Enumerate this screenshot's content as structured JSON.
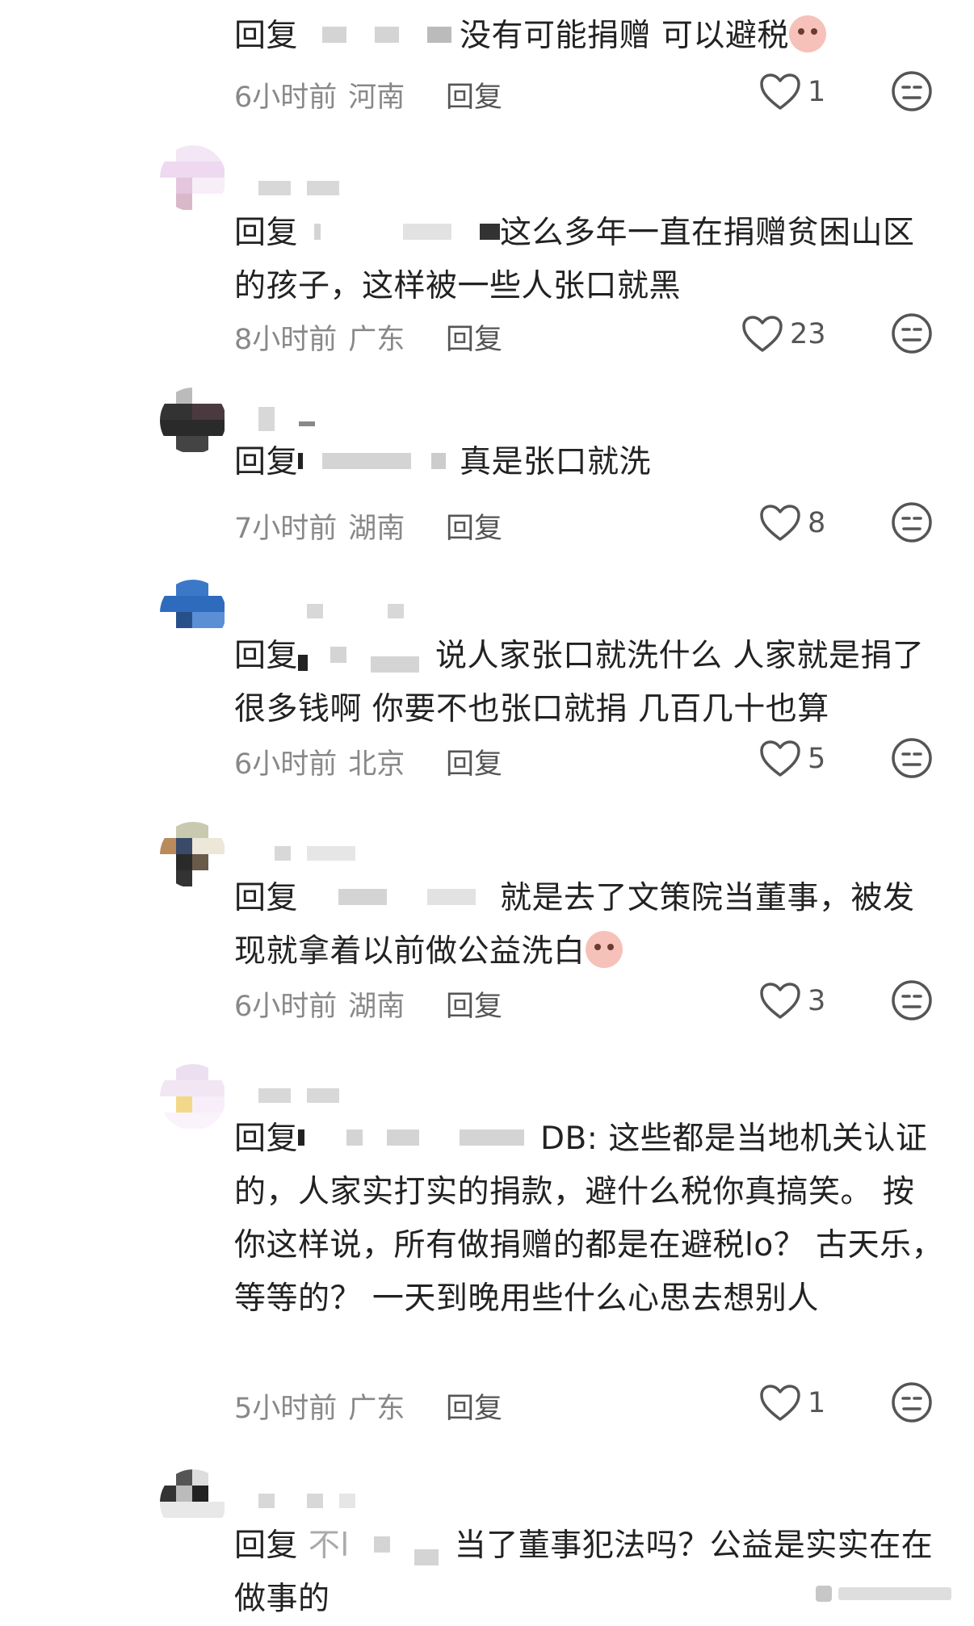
{
  "reply_label": "回复",
  "comments": [
    {
      "text_before": "",
      "text_after": "没有可能捐赠 可以避税",
      "emoji": "blush-emoji",
      "time": "6小时前",
      "location": "河南",
      "likes": "1"
    },
    {
      "text_before": "",
      "text_after": "这么多年一直在捐赠贫困山区的孩子，这样被一些人张口就黑",
      "emoji": "",
      "time": "8小时前",
      "location": "广东",
      "likes": "23"
    },
    {
      "text_before": "",
      "text_after": "真是张口就洗",
      "emoji": "",
      "time": "7小时前",
      "location": "湖南",
      "likes": "8"
    },
    {
      "text_before": "",
      "text_after": "说人家张口就洗什么 人家就是捐了很多钱啊 你要不也张口就捐 几百几十也算",
      "emoji": "",
      "time": "6小时前",
      "location": "北京",
      "likes": "5"
    },
    {
      "text_before": "",
      "text_after": "就是去了文策院当董事，被发现就拿着以前做公益洗白",
      "emoji": "thinking-emoji",
      "time": "6小时前",
      "location": "湖南",
      "likes": "3"
    },
    {
      "text_before": "",
      "text_after": "DB: 这些都是当地机关认证的，人家实打实的捐款，避什么税你真搞笑。 按你这样说，所有做捐赠的都是在避税lo？ 古天乐，等等的？ 一天到晚用些什么心思去想别人",
      "emoji": "",
      "time": "5小时前",
      "location": "广东",
      "likes": "1"
    },
    {
      "text_before": "不l",
      "text_after": "当了董事犯法吗？公益是实实在在做事的",
      "emoji": "",
      "time": "",
      "location": "",
      "likes": ""
    }
  ],
  "icons": {
    "like": "heart-outline-icon",
    "reaction": "neutral-face-icon"
  },
  "colors": {
    "text": "#222222",
    "meta": "#888888",
    "icon": "#555555"
  }
}
